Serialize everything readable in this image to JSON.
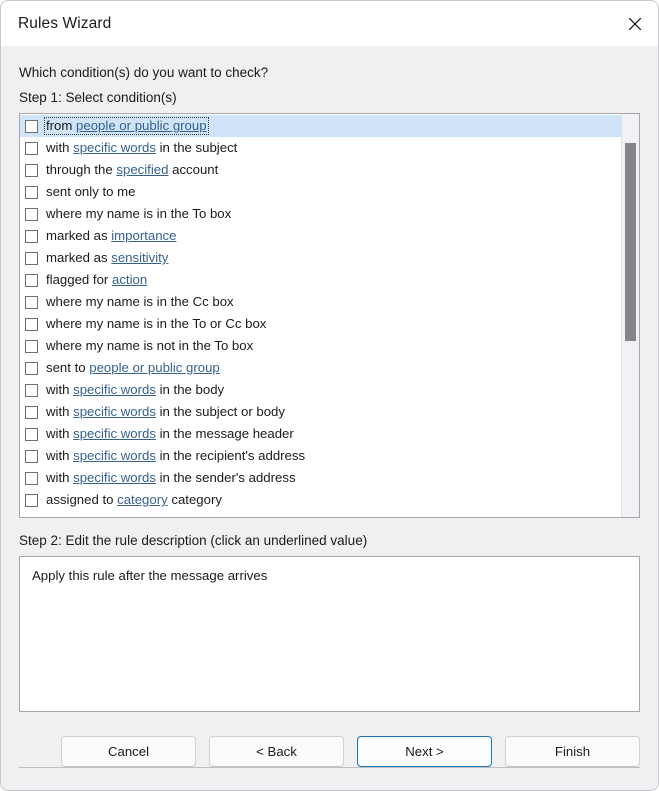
{
  "window": {
    "title": "Rules Wizard",
    "close_icon": "close-icon"
  },
  "header": {
    "prompt": "Which condition(s) do you want to check?",
    "step1_label": "Step 1: Select condition(s)"
  },
  "conditions": [
    {
      "segments": [
        {
          "text": "from ",
          "link": false
        },
        {
          "text": "people or public group",
          "link": true
        }
      ],
      "checked": false,
      "selected": true
    },
    {
      "segments": [
        {
          "text": "with ",
          "link": false
        },
        {
          "text": "specific words",
          "link": true
        },
        {
          "text": " in the subject",
          "link": false
        }
      ],
      "checked": false,
      "selected": false
    },
    {
      "segments": [
        {
          "text": "through the ",
          "link": false
        },
        {
          "text": "specified",
          "link": true
        },
        {
          "text": " account",
          "link": false
        }
      ],
      "checked": false,
      "selected": false
    },
    {
      "segments": [
        {
          "text": "sent only to me",
          "link": false
        }
      ],
      "checked": false,
      "selected": false
    },
    {
      "segments": [
        {
          "text": "where my name is in the To box",
          "link": false
        }
      ],
      "checked": false,
      "selected": false
    },
    {
      "segments": [
        {
          "text": "marked as ",
          "link": false
        },
        {
          "text": "importance",
          "link": true
        }
      ],
      "checked": false,
      "selected": false
    },
    {
      "segments": [
        {
          "text": "marked as ",
          "link": false
        },
        {
          "text": "sensitivity",
          "link": true
        }
      ],
      "checked": false,
      "selected": false
    },
    {
      "segments": [
        {
          "text": "flagged for ",
          "link": false
        },
        {
          "text": "action",
          "link": true
        }
      ],
      "checked": false,
      "selected": false
    },
    {
      "segments": [
        {
          "text": "where my name is in the Cc box",
          "link": false
        }
      ],
      "checked": false,
      "selected": false
    },
    {
      "segments": [
        {
          "text": "where my name is in the To or Cc box",
          "link": false
        }
      ],
      "checked": false,
      "selected": false
    },
    {
      "segments": [
        {
          "text": "where my name is not in the To box",
          "link": false
        }
      ],
      "checked": false,
      "selected": false
    },
    {
      "segments": [
        {
          "text": "sent to ",
          "link": false
        },
        {
          "text": "people or public group",
          "link": true
        }
      ],
      "checked": false,
      "selected": false
    },
    {
      "segments": [
        {
          "text": "with ",
          "link": false
        },
        {
          "text": "specific words",
          "link": true
        },
        {
          "text": " in the body",
          "link": false
        }
      ],
      "checked": false,
      "selected": false
    },
    {
      "segments": [
        {
          "text": "with ",
          "link": false
        },
        {
          "text": "specific words",
          "link": true
        },
        {
          "text": " in the subject or body",
          "link": false
        }
      ],
      "checked": false,
      "selected": false
    },
    {
      "segments": [
        {
          "text": "with ",
          "link": false
        },
        {
          "text": "specific words",
          "link": true
        },
        {
          "text": " in the message header",
          "link": false
        }
      ],
      "checked": false,
      "selected": false
    },
    {
      "segments": [
        {
          "text": "with ",
          "link": false
        },
        {
          "text": "specific words",
          "link": true
        },
        {
          "text": " in the recipient's address",
          "link": false
        }
      ],
      "checked": false,
      "selected": false
    },
    {
      "segments": [
        {
          "text": "with ",
          "link": false
        },
        {
          "text": "specific words",
          "link": true
        },
        {
          "text": " in the sender's address",
          "link": false
        }
      ],
      "checked": false,
      "selected": false
    },
    {
      "segments": [
        {
          "text": "assigned to ",
          "link": false
        },
        {
          "text": "category",
          "link": true
        },
        {
          "text": " category",
          "link": false
        }
      ],
      "checked": false,
      "selected": false
    }
  ],
  "step2": {
    "label": "Step 2: Edit the rule description (click an underlined value)",
    "description": "Apply this rule after the message arrives"
  },
  "footer": {
    "buttons": [
      {
        "label": "Cancel",
        "default": false
      },
      {
        "label": "< Back",
        "default": false
      },
      {
        "label": "Next >",
        "default": true
      },
      {
        "label": "Finish",
        "default": false
      }
    ]
  },
  "colors": {
    "accent": "#1a75b8",
    "selection": "#cfe4f7",
    "link": "#36618e",
    "body_background": "#f0eff1",
    "scroll_thumb": "#868589"
  }
}
